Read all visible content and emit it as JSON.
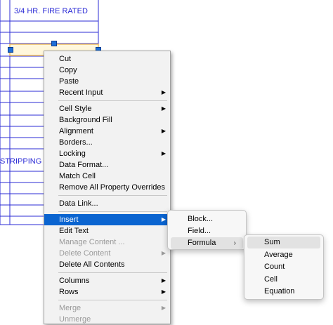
{
  "drawing": {
    "table_text_1": "3/4 HR. FIRE RATED",
    "table_text_2": "STRIPPING",
    "line_color": "#2b2bd6",
    "selection_color": "#f0c060"
  },
  "context_menu": {
    "groups": [
      [
        {
          "label": "Cut",
          "disabled": false,
          "has_submenu": false
        },
        {
          "label": "Copy",
          "disabled": false,
          "has_submenu": false
        },
        {
          "label": "Paste",
          "disabled": false,
          "has_submenu": false
        },
        {
          "label": "Recent Input",
          "disabled": false,
          "has_submenu": true
        }
      ],
      [
        {
          "label": "Cell Style",
          "disabled": false,
          "has_submenu": true
        },
        {
          "label": "Background Fill",
          "disabled": false,
          "has_submenu": false
        },
        {
          "label": "Alignment",
          "disabled": false,
          "has_submenu": true
        },
        {
          "label": "Borders...",
          "disabled": false,
          "has_submenu": false
        },
        {
          "label": "Locking",
          "disabled": false,
          "has_submenu": true
        },
        {
          "label": "Data Format...",
          "disabled": false,
          "has_submenu": false
        },
        {
          "label": "Match Cell",
          "disabled": false,
          "has_submenu": false
        },
        {
          "label": "Remove All Property Overrides",
          "disabled": false,
          "has_submenu": false
        }
      ],
      [
        {
          "label": "Data Link...",
          "disabled": false,
          "has_submenu": false
        }
      ],
      [
        {
          "label": "Insert",
          "disabled": false,
          "has_submenu": true,
          "highlighted": true
        },
        {
          "label": "Edit Text",
          "disabled": false,
          "has_submenu": false
        },
        {
          "label": "Manage Content ...",
          "disabled": true,
          "has_submenu": false
        },
        {
          "label": "Delete Content",
          "disabled": true,
          "has_submenu": true
        },
        {
          "label": "Delete All Contents",
          "disabled": false,
          "has_submenu": false
        }
      ],
      [
        {
          "label": "Columns",
          "disabled": false,
          "has_submenu": true
        },
        {
          "label": "Rows",
          "disabled": false,
          "has_submenu": true
        }
      ],
      [
        {
          "label": "Merge",
          "disabled": true,
          "has_submenu": true
        },
        {
          "label": "Unmerge",
          "disabled": true,
          "has_submenu": false
        }
      ]
    ],
    "highlight_color": "#0a64d0"
  },
  "insert_submenu": {
    "items": [
      {
        "label": "Block...",
        "has_submenu": false
      },
      {
        "label": "Field...",
        "has_submenu": false
      },
      {
        "label": "Formula",
        "has_submenu": true,
        "hover": true
      }
    ]
  },
  "formula_submenu": {
    "items": [
      {
        "label": "Sum",
        "hover": true
      },
      {
        "label": "Average"
      },
      {
        "label": "Count"
      },
      {
        "label": "Cell"
      },
      {
        "label": "Equation"
      }
    ]
  },
  "icons": {
    "submenu_arrow": "right-triangle-icon",
    "chevron": "chevron-right-icon"
  }
}
